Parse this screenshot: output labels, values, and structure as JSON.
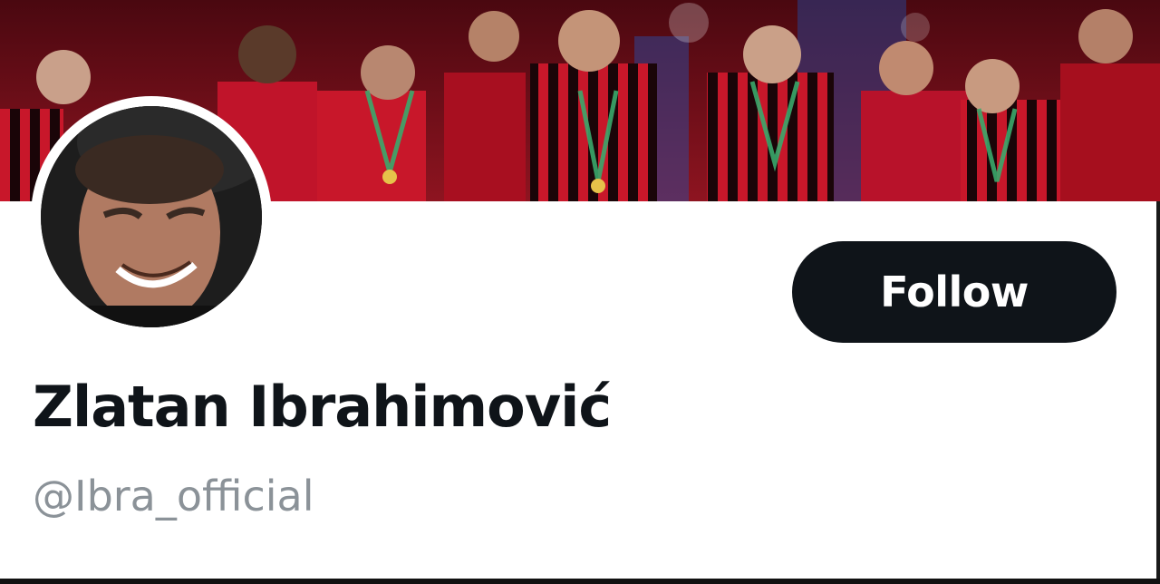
{
  "profile": {
    "display_name": "Zlatan Ibrahimović",
    "handle": "@Ibra_official",
    "follow_label": "Follow"
  },
  "colors": {
    "follow_button_bg": "#0f1419",
    "follow_button_text": "#ffffff",
    "name_text": "#0f1419",
    "handle_text": "#8b9298",
    "banner_red": "#b3121f"
  },
  "icons": {
    "banner": "team-celebration-photo",
    "avatar": "profile-photo"
  }
}
